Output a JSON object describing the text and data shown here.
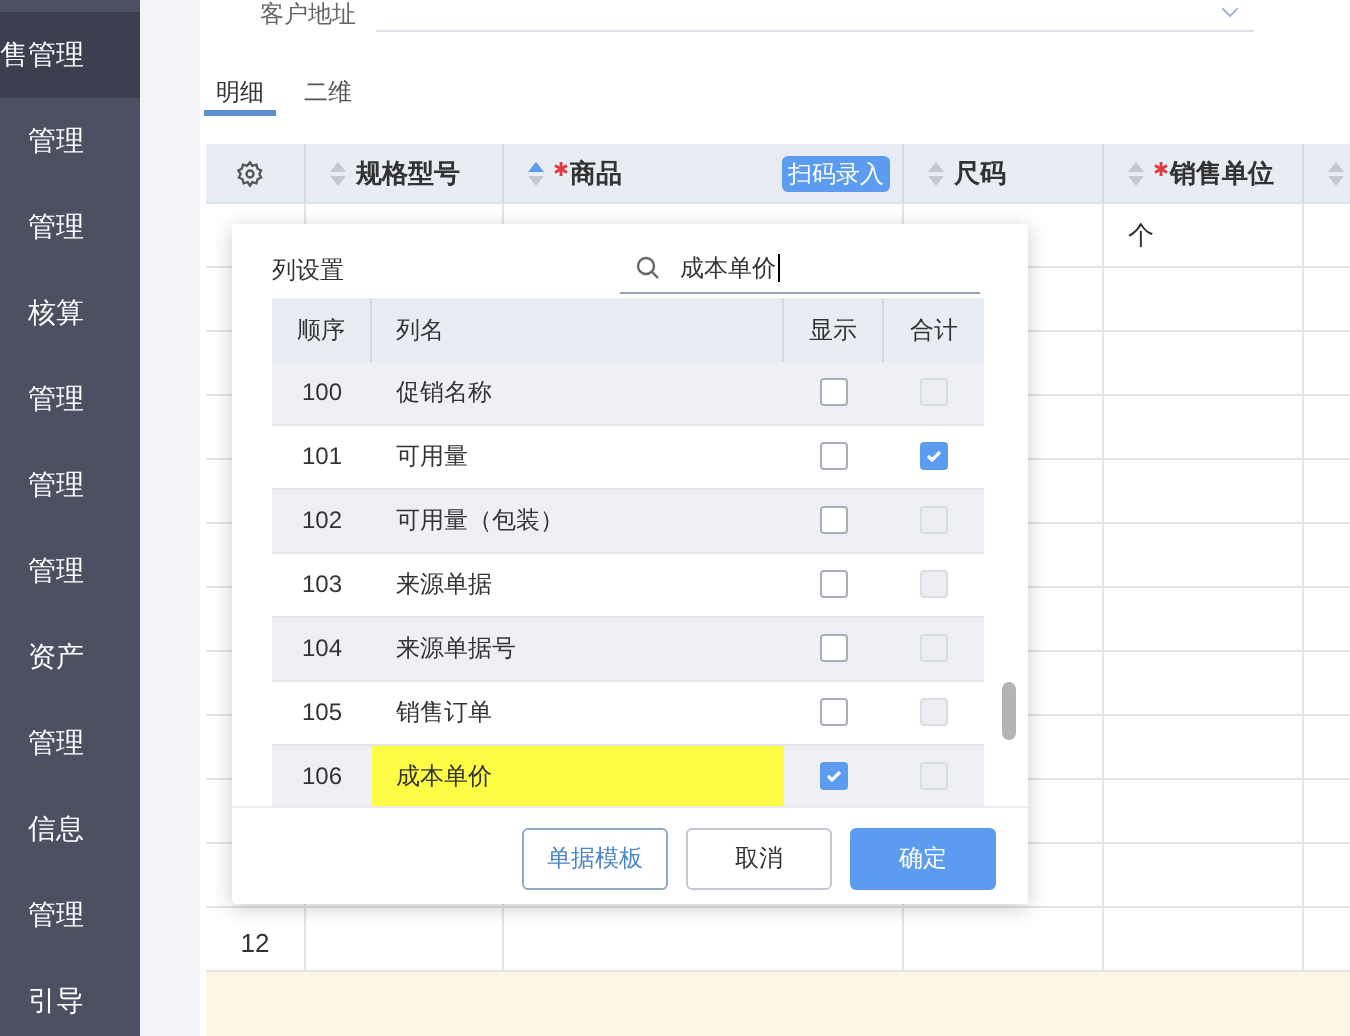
{
  "sidebar": {
    "items": [
      {
        "label": "售管理",
        "selected": true
      },
      {
        "label": "管理",
        "selected": false
      },
      {
        "label": "管理",
        "selected": false
      },
      {
        "label": "核算",
        "selected": false
      },
      {
        "label": "管理",
        "selected": false
      },
      {
        "label": "管理",
        "selected": false
      },
      {
        "label": "管理",
        "selected": false
      },
      {
        "label": "资产",
        "selected": false
      },
      {
        "label": "管理",
        "selected": false
      },
      {
        "label": "信息",
        "selected": false
      },
      {
        "label": "管理",
        "selected": false
      },
      {
        "label": "引导",
        "selected": false
      }
    ]
  },
  "address_field": {
    "label": "客户地址"
  },
  "tabs": [
    {
      "label": "明细",
      "selected": true
    },
    {
      "label": "二维",
      "selected": false
    }
  ],
  "table": {
    "columns": [
      {
        "kind": "settings"
      },
      {
        "kind": "column",
        "label": "规格型号",
        "required": false,
        "sorted_ascending": false
      },
      {
        "kind": "column",
        "label": "商品",
        "required": true,
        "sorted_ascending": true,
        "badge": "扫码录入"
      },
      {
        "kind": "column",
        "label": "尺码",
        "required": false,
        "sorted_ascending": false
      },
      {
        "kind": "column",
        "label": "销售单位",
        "required": true,
        "sorted_ascending": false
      },
      {
        "kind": "column",
        "sorted_ascending": false
      }
    ],
    "rows": [
      {
        "cells": [
          "",
          "",
          "",
          "",
          "个",
          ""
        ]
      },
      {
        "cells": [
          "",
          "",
          "",
          "",
          "",
          ""
        ]
      },
      {
        "cells": [
          "",
          "",
          "",
          "",
          "",
          ""
        ]
      },
      {
        "cells": [
          "",
          "",
          "",
          "",
          "",
          ""
        ]
      },
      {
        "cells": [
          "",
          "",
          "",
          "",
          "",
          ""
        ]
      },
      {
        "cells": [
          "",
          "",
          "",
          "",
          "",
          ""
        ]
      },
      {
        "cells": [
          "",
          "",
          "",
          "",
          "",
          ""
        ]
      },
      {
        "cells": [
          "",
          "",
          "",
          "",
          "",
          ""
        ]
      },
      {
        "cells": [
          "",
          "",
          "",
          "",
          "",
          ""
        ]
      },
      {
        "cells": [
          "",
          "",
          "",
          "",
          "",
          ""
        ]
      },
      {
        "cells": [
          "",
          "",
          "",
          "",
          "",
          ""
        ]
      },
      {
        "cells": [
          "12",
          "",
          "",
          "",
          "",
          ""
        ]
      }
    ]
  },
  "column_settings": {
    "title": "列设置",
    "search": {
      "value": "成本单价"
    },
    "columns": [
      "顺序",
      "列名",
      "显示",
      "合计"
    ],
    "rows": [
      {
        "order": "100",
        "name": "促销名称",
        "show": false,
        "sum": false,
        "sum_disabled": true,
        "highlighted": false
      },
      {
        "order": "101",
        "name": "可用量",
        "show": false,
        "sum": true,
        "sum_disabled": false,
        "highlighted": false
      },
      {
        "order": "102",
        "name": "可用量（包装）",
        "show": false,
        "sum": false,
        "sum_disabled": true,
        "highlighted": false
      },
      {
        "order": "103",
        "name": "来源单据",
        "show": false,
        "sum": false,
        "sum_disabled": true,
        "highlighted": false
      },
      {
        "order": "104",
        "name": "来源单据号",
        "show": false,
        "sum": false,
        "sum_disabled": true,
        "highlighted": false
      },
      {
        "order": "105",
        "name": "销售订单",
        "show": false,
        "sum": false,
        "sum_disabled": true,
        "highlighted": false
      },
      {
        "order": "106",
        "name": "成本单价",
        "show": true,
        "sum": false,
        "sum_disabled": true,
        "highlighted": true
      }
    ],
    "buttons": [
      {
        "label": "单据模板",
        "kind": "outline"
      },
      {
        "label": "取消",
        "kind": "default"
      },
      {
        "label": "确定",
        "kind": "primary"
      }
    ]
  }
}
